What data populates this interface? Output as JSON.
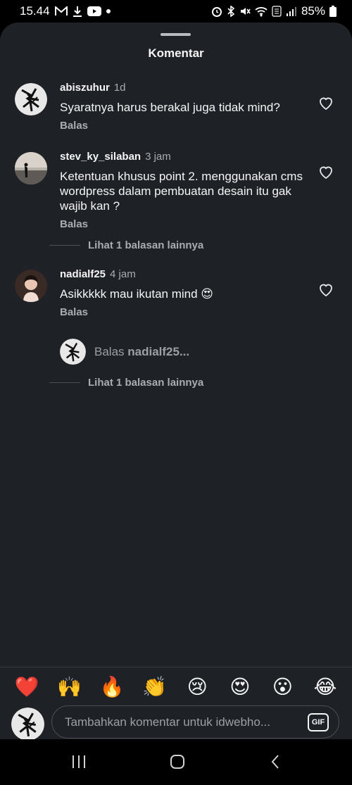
{
  "status_bar": {
    "time": "15.44",
    "battery": "85%",
    "left_icons": [
      "gmail-icon",
      "download-icon",
      "youtube-icon",
      "dot-icon"
    ],
    "right_icons": [
      "alarm-icon",
      "bluetooth-icon",
      "mute-icon",
      "wifi-icon",
      "volte-icon",
      "signal-icon",
      "battery-icon"
    ]
  },
  "sheet": {
    "title": "Komentar"
  },
  "comments": [
    {
      "username": "abiszuhur",
      "time": "1d",
      "text": "Syaratnya harus berakal juga tidak mind?",
      "reply_label": "Balas"
    },
    {
      "username": "stev_ky_silaban",
      "time": "3 jam",
      "text": "Ketentuan khusus point 2. menggunakan cms wordpress dalam pembuatan desain itu gak wajib kan ?",
      "reply_label": "Balas",
      "more_replies": "Lihat 1 balasan lainnya"
    },
    {
      "username": "nadialf25",
      "time": "4 jam",
      "text": "Asikkkkk mau ikutan mind 😍",
      "reply_label": "Balas",
      "more_replies": "Lihat 1 balasan lainnya"
    }
  ],
  "reply_prompt": {
    "prefix": "Balas",
    "target": "nadialf25..."
  },
  "emoji_bar": [
    "❤️",
    "🙌",
    "🔥",
    "👏",
    "😢",
    "😍",
    "😮",
    "😂"
  ],
  "composer": {
    "placeholder": "Tambahkan komentar untuk idwebho...",
    "gif_label": "GIF"
  },
  "nav": [
    "recents-icon",
    "home-icon",
    "back-icon"
  ],
  "colors": {
    "sheet_bg": "#1e2226",
    "text_primary": "#f5f5f5",
    "text_secondary": "#a8adb3"
  }
}
